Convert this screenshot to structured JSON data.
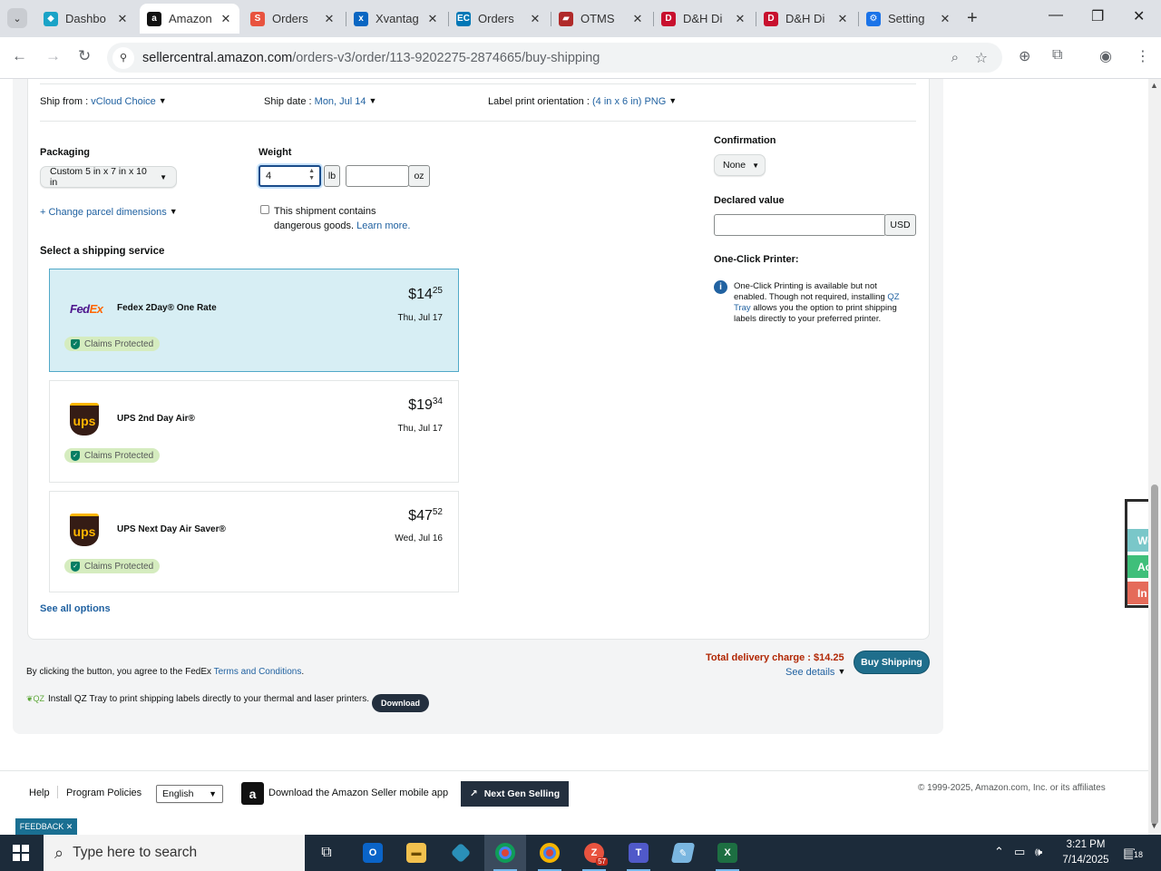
{
  "browser": {
    "tabs": [
      {
        "label": "Dashbo",
        "icon": "dashboard-icon",
        "color": "#1aa3c7"
      },
      {
        "label": "Amazon",
        "icon": "amazon-icon",
        "color": "#111111",
        "active": true
      },
      {
        "label": "Orders",
        "icon": "shipstation-icon",
        "color": "#e8533f"
      },
      {
        "label": "Xvantag",
        "icon": "xvantage-icon",
        "color": "#0a66c2"
      },
      {
        "label": "Orders",
        "icon": "ec-icon",
        "color": "#0077b6"
      },
      {
        "label": "OTMS",
        "icon": "truck-icon",
        "color": "#b02a2a"
      },
      {
        "label": "D&H Di",
        "icon": "dh-icon",
        "color": "#c8102e"
      },
      {
        "label": "D&H Di",
        "icon": "dh-icon",
        "color": "#c8102e"
      },
      {
        "label": "Setting",
        "icon": "gear-icon",
        "color": "#1a73e8"
      }
    ],
    "url_host": "sellercentral.amazon.com",
    "url_path": "/orders-v3/order/113-9202275-2874665/buy-shipping"
  },
  "shipment": {
    "ship_from_label": "Ship from :",
    "ship_from_value": "vCloud Choice",
    "ship_date_label": "Ship date :",
    "ship_date_value": "Mon, Jul 14",
    "label_orientation_label": "Label print orientation :",
    "label_orientation_value": "(4 in x 6 in) PNG",
    "packaging_label": "Packaging",
    "packaging_value": "Custom 5 in x 7 in x 10 in",
    "change_dims": "+ Change parcel dimensions",
    "weight_label": "Weight",
    "weight_lb": "4",
    "weight_oz": "",
    "lb_unit": "lb",
    "oz_unit": "oz",
    "dangerous_text_1": "This shipment contains",
    "dangerous_text_2": "dangerous goods.",
    "learn_more": "Learn more.",
    "confirmation_label": "Confirmation",
    "confirmation_value": "None",
    "declared_label": "Declared value",
    "declared_value": "",
    "declared_unit": "USD",
    "printer_label": "One-Click Printer:",
    "printer_info_1": "One-Click Printing is available but not",
    "printer_info_2": "enabled. Though not required, installing",
    "printer_info_link_a": "QZ",
    "printer_info_link_b": "Tray",
    "printer_info_3": "allows you the option to print shipping",
    "printer_info_4": "labels directly to your preferred printer."
  },
  "services_heading": "Select a shipping service",
  "services": [
    {
      "carrier": "FedEx",
      "name": "Fedex 2Day® One Rate",
      "dollars": "$14",
      "cents": "25",
      "date": "Thu, Jul 17",
      "badge": "Claims Protected",
      "selected": true
    },
    {
      "carrier": "UPS",
      "name": "UPS 2nd Day Air®",
      "dollars": "$19",
      "cents": "34",
      "date": "Thu, Jul 17",
      "badge": "Claims Protected",
      "selected": false
    },
    {
      "carrier": "UPS",
      "name": "UPS Next Day Air Saver®",
      "dollars": "$47",
      "cents": "52",
      "date": "Wed, Jul 16",
      "badge": "Claims Protected",
      "selected": false
    }
  ],
  "see_all": "See all options",
  "agreement_prefix": "By clicking the button, you agree to the FedEx",
  "agreement_link": "Terms and Conditions",
  "agreement_suffix": ".",
  "qz_text": "Install QZ Tray to print shipping labels directly to your thermal and laser printers.",
  "download": "Download",
  "total_charge": "Total delivery charge : $14.25",
  "see_details": "See details",
  "buy_shipping": "Buy Shipping",
  "footer": {
    "help": "Help",
    "policies": "Program Policies",
    "language": "English",
    "app_download": "Download the Amazon Seller mobile app",
    "next_gen": "Next Gen Selling",
    "copyright": "© 1999-2025, Amazon.com, Inc. or its affiliates"
  },
  "feedback": "FEEDBACK ✕",
  "side_tabs": [
    "Worl",
    "Activ",
    "In Ac"
  ],
  "taskbar": {
    "search_placeholder": "Type here to search",
    "zoom_badge": "57",
    "time": "3:21 PM",
    "date": "7/14/2025",
    "notifications": "18"
  }
}
